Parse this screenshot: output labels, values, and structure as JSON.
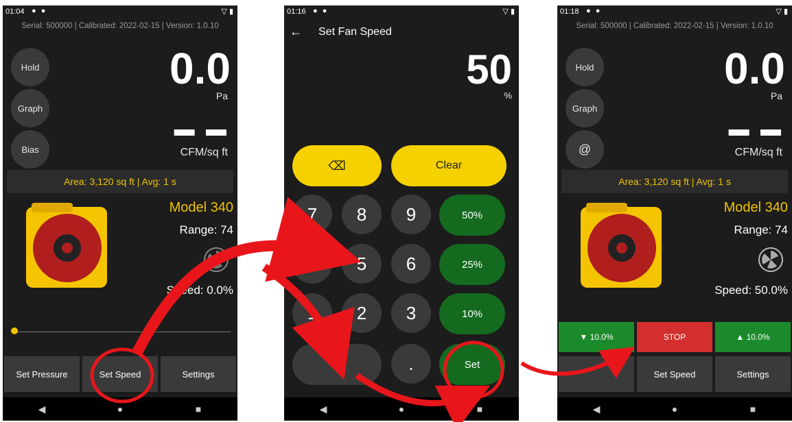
{
  "screen1": {
    "status": {
      "time": "01:04",
      "icons": "● ●",
      "signal": "▽ ▮"
    },
    "info": {
      "serial": "Serial: 500000",
      "calibrated": "Calibrated: 2022-02-15",
      "version": "Version: 1.0.10"
    },
    "left_buttons": [
      "Hold",
      "Graph",
      "Bias"
    ],
    "reading": {
      "value": "0.0",
      "unit": "Pa",
      "dashes": "▬ ▬",
      "cfm_unit": "CFM/sq ft"
    },
    "area": "Area: 3,120 sq ft  |  Avg: 1 s",
    "model": "Model 340",
    "range": "Range: 74",
    "speed": "Speed: 0.0%",
    "bottom": [
      "Set Pressure",
      "Set Speed",
      "Settings"
    ]
  },
  "screen2": {
    "status": {
      "time": "01:16",
      "icons": "● ●",
      "signal": "▽ ▮"
    },
    "back": "←",
    "title": "Set Fan Speed",
    "value": "50",
    "unit": "%",
    "backspace": "⌫",
    "clear": "Clear",
    "keys": [
      "7",
      "8",
      "9",
      "4",
      "5",
      "6",
      "1",
      "2",
      "3",
      "0",
      "."
    ],
    "presets": [
      "50%",
      "25%",
      "10%"
    ],
    "set": "Set"
  },
  "screen3": {
    "status": {
      "time": "01:18",
      "icons": "● ●",
      "signal": "▽ ▮"
    },
    "info": {
      "serial": "Serial: 500000",
      "calibrated": "Calibrated: 2022-02-15",
      "version": "Version: 1.0.10"
    },
    "left_buttons": [
      "Hold",
      "Graph",
      "@"
    ],
    "reading": {
      "value": "0.0",
      "unit": "Pa",
      "dashes": "▬ ▬",
      "cfm_unit": "CFM/sq ft"
    },
    "area": "Area: 3,120 sq ft  |  Avg: 1 s",
    "model": "Model 340",
    "range": "Range: 74",
    "speed": "Speed: 50.0%",
    "controls": [
      "▼ 10.0%",
      "STOP",
      "▲ 10.0%"
    ],
    "bottom": [
      "",
      "Set Speed",
      "Settings"
    ]
  },
  "nav": {
    "back": "◀",
    "home": "●",
    "recent": "■"
  },
  "colors": {
    "accent_yellow": "#f5d100",
    "model_yellow": "#f2c400",
    "green": "#1b8a2a",
    "stop_red": "#d32f2f",
    "annotation_red": "#e8161b"
  }
}
